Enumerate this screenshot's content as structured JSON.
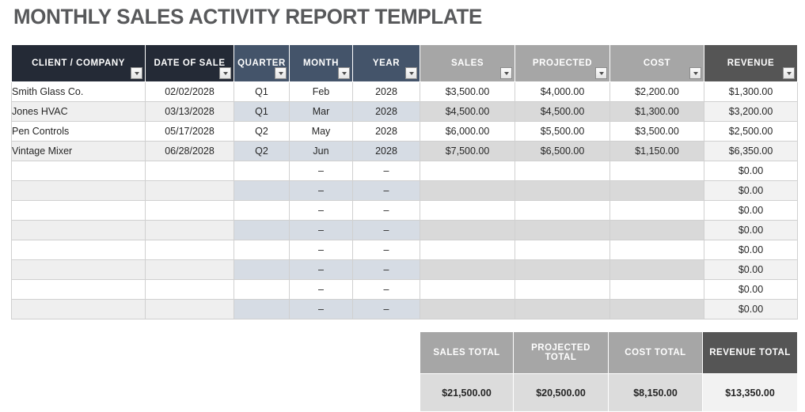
{
  "title": "MONTHLY SALES ACTIVITY REPORT TEMPLATE",
  "colors": {
    "title_text": "#58595b",
    "header_dark": "#242a36",
    "header_blue": "#44546a",
    "header_gray": "#a6a6a6",
    "header_charcoal": "#555555",
    "zebra_client": "#efefef",
    "zebra_quarter": "#d6dce4",
    "zebra_money": "#d9d9d9",
    "zebra_revenue": "#f2f2f2",
    "resize_handle": "#4a55a5"
  },
  "table": {
    "columns": [
      {
        "label": "CLIENT / COMPANY",
        "style": "hdr-dark",
        "filter": true
      },
      {
        "label": "DATE OF SALE",
        "style": "hdr-dark",
        "filter": true
      },
      {
        "label": "QUARTER",
        "style": "hdr-blue",
        "filter": true
      },
      {
        "label": "MONTH",
        "style": "hdr-blue",
        "filter": true
      },
      {
        "label": "YEAR",
        "style": "hdr-blue",
        "filter": true
      },
      {
        "label": "SALES",
        "style": "hdr-gray",
        "filter": true
      },
      {
        "label": "PROJECTED",
        "style": "hdr-gray",
        "filter": true
      },
      {
        "label": "COST",
        "style": "hdr-gray",
        "filter": true
      },
      {
        "label": "REVENUE",
        "style": "hdr-charcoal",
        "filter": true
      }
    ],
    "rows": [
      {
        "client": "Smith Glass Co.",
        "date": "02/02/2028",
        "quarter": "Q1",
        "month": "Feb",
        "year": "2028",
        "sales": "$3,500.00",
        "projected": "$4,000.00",
        "cost": "$2,200.00",
        "revenue": "$1,300.00"
      },
      {
        "client": "Jones HVAC",
        "date": "03/13/2028",
        "quarter": "Q1",
        "month": "Mar",
        "year": "2028",
        "sales": "$4,500.00",
        "projected": "$4,500.00",
        "cost": "$1,300.00",
        "revenue": "$3,200.00"
      },
      {
        "client": "Pen Controls",
        "date": "05/17/2028",
        "quarter": "Q2",
        "month": "May",
        "year": "2028",
        "sales": "$6,000.00",
        "projected": "$5,500.00",
        "cost": "$3,500.00",
        "revenue": "$2,500.00"
      },
      {
        "client": "Vintage Mixer",
        "date": "06/28/2028",
        "quarter": "Q2",
        "month": "Jun",
        "year": "2028",
        "sales": "$7,500.00",
        "projected": "$6,500.00",
        "cost": "$1,150.00",
        "revenue": "$6,350.00"
      },
      {
        "client": "",
        "date": "",
        "quarter": "",
        "month": "–",
        "year": "–",
        "sales": "",
        "projected": "",
        "cost": "",
        "revenue": "$0.00"
      },
      {
        "client": "",
        "date": "",
        "quarter": "",
        "month": "–",
        "year": "–",
        "sales": "",
        "projected": "",
        "cost": "",
        "revenue": "$0.00"
      },
      {
        "client": "",
        "date": "",
        "quarter": "",
        "month": "–",
        "year": "–",
        "sales": "",
        "projected": "",
        "cost": "",
        "revenue": "$0.00"
      },
      {
        "client": "",
        "date": "",
        "quarter": "",
        "month": "–",
        "year": "–",
        "sales": "",
        "projected": "",
        "cost": "",
        "revenue": "$0.00"
      },
      {
        "client": "",
        "date": "",
        "quarter": "",
        "month": "–",
        "year": "–",
        "sales": "",
        "projected": "",
        "cost": "",
        "revenue": "$0.00"
      },
      {
        "client": "",
        "date": "",
        "quarter": "",
        "month": "–",
        "year": "–",
        "sales": "",
        "projected": "",
        "cost": "",
        "revenue": "$0.00"
      },
      {
        "client": "",
        "date": "",
        "quarter": "",
        "month": "–",
        "year": "–",
        "sales": "",
        "projected": "",
        "cost": "",
        "revenue": "$0.00"
      },
      {
        "client": "",
        "date": "",
        "quarter": "",
        "month": "–",
        "year": "–",
        "sales": "",
        "projected": "",
        "cost": "",
        "revenue": "$0.00"
      }
    ]
  },
  "totals": {
    "headers": [
      {
        "label": "SALES TOTAL",
        "style": "hdr-gray"
      },
      {
        "label": "PROJECTED TOTAL",
        "style": "hdr-gray"
      },
      {
        "label": "COST TOTAL",
        "style": "hdr-gray"
      },
      {
        "label": "REVENUE TOTAL",
        "style": "hdr-charcoal"
      }
    ],
    "values": [
      {
        "value": "$21,500.00",
        "style": "t-gray"
      },
      {
        "value": "$20,500.00",
        "style": "t-gray"
      },
      {
        "value": "$8,150.00",
        "style": "t-gray"
      },
      {
        "value": "$13,350.00",
        "style": "t-light"
      }
    ]
  }
}
